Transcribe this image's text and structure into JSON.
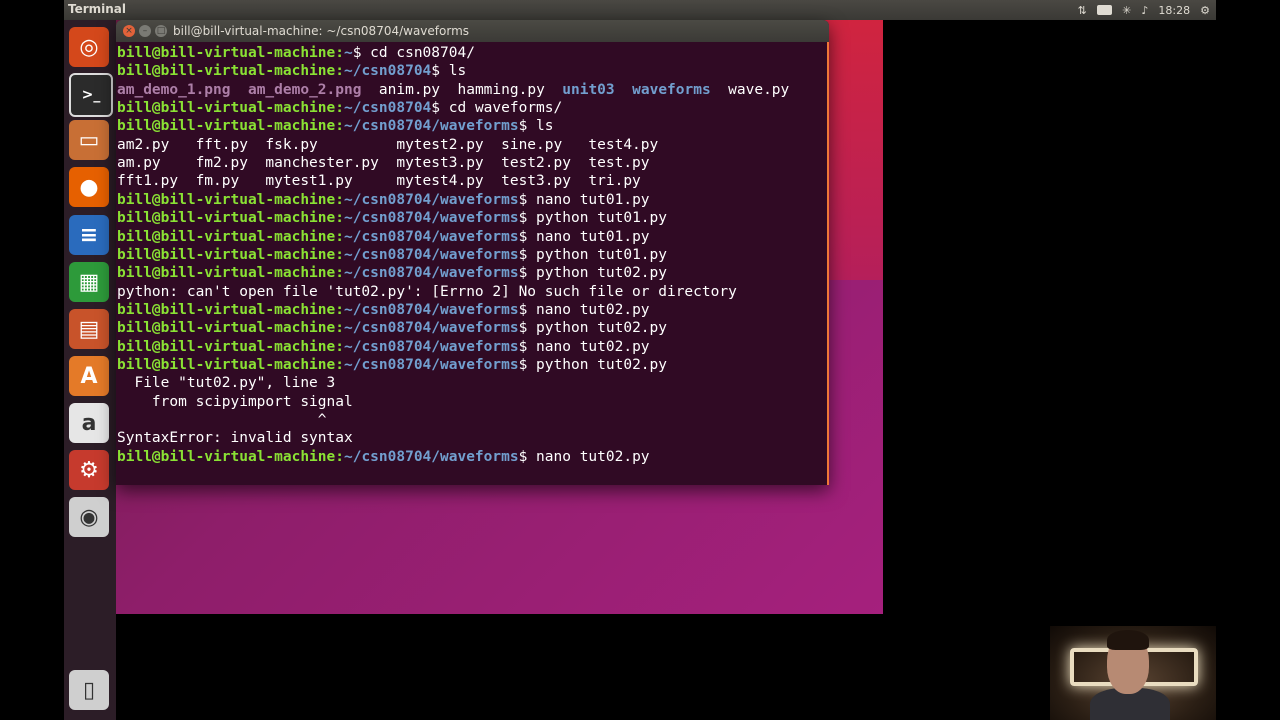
{
  "topbar": {
    "title": "Terminal",
    "input_method": "En",
    "volume_icon": "♪",
    "time": "18:28"
  },
  "launcher": {
    "items": [
      {
        "name": "ubuntu-dash-icon",
        "glyph": "◎",
        "bg": "#d4481b"
      },
      {
        "name": "terminal-icon",
        "glyph": ">_",
        "bg": "#2b2b2b"
      },
      {
        "name": "files-icon",
        "glyph": "▭",
        "bg": "#c86f35"
      },
      {
        "name": "firefox-icon",
        "glyph": "●",
        "bg": "#e66000"
      },
      {
        "name": "libreoffice-writer-icon",
        "glyph": "≡",
        "bg": "#2a6bbd"
      },
      {
        "name": "libreoffice-calc-icon",
        "glyph": "▦",
        "bg": "#2d9a3a"
      },
      {
        "name": "libreoffice-impress-icon",
        "glyph": "▤",
        "bg": "#c8532a"
      },
      {
        "name": "software-center-icon",
        "glyph": "A",
        "bg": "#e47a28"
      },
      {
        "name": "amazon-icon",
        "glyph": "a",
        "bg": "#e6e6e6"
      },
      {
        "name": "system-settings-icon",
        "glyph": "⚙",
        "bg": "#c63a2d"
      },
      {
        "name": "dvd-icon",
        "glyph": "◉",
        "bg": "#cfcfcf"
      },
      {
        "name": "trash-icon",
        "glyph": "▯",
        "bg": "#cfcfcf"
      }
    ]
  },
  "terminal": {
    "window_title": "bill@bill-virtual-machine: ~/csn08704/waveforms",
    "close_glyph": "×",
    "minimize_glyph": "–",
    "maximize_glyph": "□",
    "lines": [
      {
        "user": "bill@bill-virtual-machine",
        "path": "~",
        "cmd": "$ cd csn08704/"
      },
      {
        "user": "bill@bill-virtual-machine",
        "path": "~/csn08704",
        "cmd": "$ ls"
      },
      {
        "files": [
          {
            "t": "am_demo_1.png",
            "k": "img"
          },
          {
            "t": "  "
          },
          {
            "t": "am_demo_2.png",
            "k": "img"
          },
          {
            "t": "  anim.py  hamming.py  "
          },
          {
            "t": "unit03",
            "k": "d"
          },
          {
            "t": "  "
          },
          {
            "t": "waveforms",
            "k": "d"
          },
          {
            "t": "  wave.py"
          }
        ]
      },
      {
        "user": "bill@bill-virtual-machine",
        "path": "~/csn08704",
        "cmd": "$ cd waveforms/"
      },
      {
        "user": "bill@bill-virtual-machine",
        "path": "~/csn08704/waveforms",
        "cmd": "$ ls"
      },
      {
        "text": "am2.py   fft.py  fsk.py         mytest2.py  sine.py   test4.py"
      },
      {
        "text": "am.py    fm2.py  manchester.py  mytest3.py  test2.py  test.py"
      },
      {
        "text": "fft1.py  fm.py   mytest1.py     mytest4.py  test3.py  tri.py"
      },
      {
        "user": "bill@bill-virtual-machine",
        "path": "~/csn08704/waveforms",
        "cmd": "$ nano tut01.py"
      },
      {
        "user": "bill@bill-virtual-machine",
        "path": "~/csn08704/waveforms",
        "cmd": "$ python tut01.py"
      },
      {
        "user": "bill@bill-virtual-machine",
        "path": "~/csn08704/waveforms",
        "cmd": "$ nano tut01.py"
      },
      {
        "user": "bill@bill-virtual-machine",
        "path": "~/csn08704/waveforms",
        "cmd": "$ python tut01.py"
      },
      {
        "user": "bill@bill-virtual-machine",
        "path": "~/csn08704/waveforms",
        "cmd": "$ python tut02.py"
      },
      {
        "text": "python: can't open file 'tut02.py': [Errno 2] No such file or directory"
      },
      {
        "user": "bill@bill-virtual-machine",
        "path": "~/csn08704/waveforms",
        "cmd": "$ nano tut02.py"
      },
      {
        "user": "bill@bill-virtual-machine",
        "path": "~/csn08704/waveforms",
        "cmd": "$ python tut02.py"
      },
      {
        "user": "bill@bill-virtual-machine",
        "path": "~/csn08704/waveforms",
        "cmd": "$ nano tut02.py"
      },
      {
        "user": "bill@bill-virtual-machine",
        "path": "~/csn08704/waveforms",
        "cmd": "$ python tut02.py"
      },
      {
        "text": "  File \"tut02.py\", line 3"
      },
      {
        "text": "    from scipyimport signal"
      },
      {
        "text": "                       ^"
      },
      {
        "text": "SyntaxError: invalid syntax"
      },
      {
        "user": "bill@bill-virtual-machine",
        "path": "~/csn08704/waveforms",
        "cmd": "$ nano tut02.py"
      }
    ]
  }
}
